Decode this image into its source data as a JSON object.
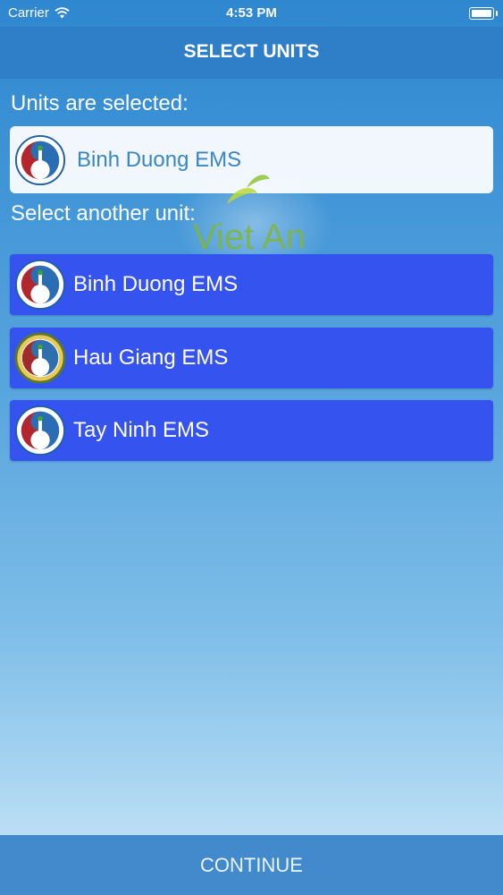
{
  "status_bar": {
    "carrier": "Carrier",
    "time": "4:53 PM"
  },
  "nav": {
    "title": "SELECT UNITS"
  },
  "selected_section": {
    "label": "Units are selected:",
    "unit": {
      "name": "Binh Duong EMS",
      "icon": "tnmt-logo-icon"
    }
  },
  "available_section": {
    "label": "Select another unit:",
    "units": [
      {
        "name": "Binh Duong EMS",
        "icon": "tnmt-logo-icon"
      },
      {
        "name": "Hau Giang EMS",
        "icon": "hau-giang-logo-icon"
      },
      {
        "name": "Tay Ninh EMS",
        "icon": "tnmt-logo-icon"
      }
    ]
  },
  "watermark": {
    "text": "Viet An"
  },
  "footer": {
    "continue_label": "CONTINUE"
  },
  "colors": {
    "nav": "#2e7fc8",
    "unit_button": "#3553ee",
    "selected_text": "#3a86c4"
  }
}
